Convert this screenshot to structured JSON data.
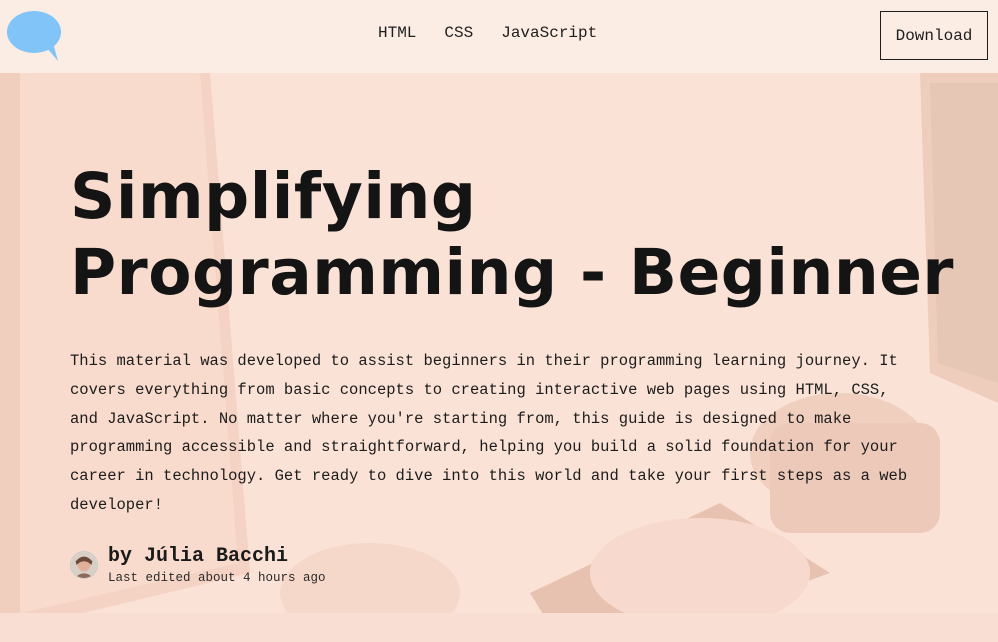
{
  "header": {
    "logo_icon": "speech-bubble-icon",
    "nav": [
      "HTML",
      "CSS",
      "JavaScript"
    ],
    "download_label": "Download"
  },
  "hero": {
    "title_line1": "Simplifying",
    "title_line2": "Programming - Beginner",
    "description": "This material was developed to assist beginners in their programming learning journey. It covers everything from basic concepts to creating interactive web pages using HTML, CSS, and JavaScript. No matter where you're starting from, this guide is designed to make programming accessible and straightforward, helping you build a solid foundation for your career in technology. Get ready to dive into this world and take your first steps as a web developer!",
    "author": "by Júlia Bacchi",
    "edited": "Last edited about 4 hours ago"
  },
  "colors": {
    "header_bg": "#fbece4",
    "hero_tint": "#fae0d4",
    "logo_blue": "#80c4f8",
    "text": "#151515"
  }
}
